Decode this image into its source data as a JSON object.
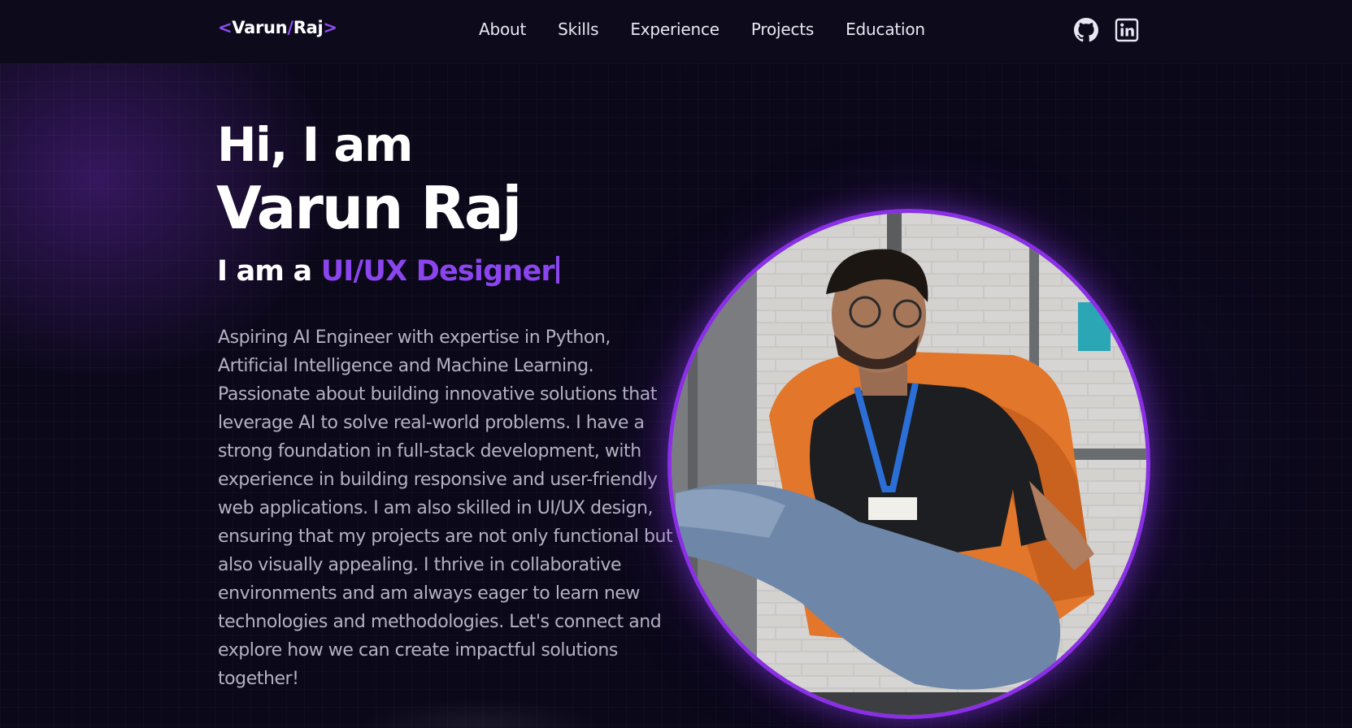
{
  "nav": {
    "logo": {
      "open_bracket": "<",
      "first": "Varun",
      "slash": "/",
      "last": "Raj",
      "close_bracket": ">"
    },
    "links": [
      {
        "label": "About"
      },
      {
        "label": "Skills"
      },
      {
        "label": "Experience"
      },
      {
        "label": "Projects"
      },
      {
        "label": "Education"
      }
    ],
    "social": [
      {
        "icon": "github-icon"
      },
      {
        "icon": "linkedin-icon"
      }
    ]
  },
  "hero": {
    "greeting": "Hi, I am",
    "name": "Varun Raj",
    "role_prefix": "I am a ",
    "role": "UI/UX Designer",
    "bio": "Aspiring AI Engineer with expertise in Python, Artificial Intelligence and Machine Learning. Passionate about building innovative solutions that leverage AI to solve real-world problems. I have a strong foundation in full-stack development, with experience in building responsive and user-friendly web applications. I am also skilled in UI/UX design, ensuring that my projects are not only functional but also visually appealing. I thrive in collaborative environments and am always eager to learn new technologies and methodologies. Let's connect and explore how we can create impactful solutions together!"
  },
  "colors": {
    "background": "#0b0819",
    "accent": "#8a45ee",
    "photo_ring": "#8a2fe6",
    "body_text": "#b4b1c3"
  }
}
